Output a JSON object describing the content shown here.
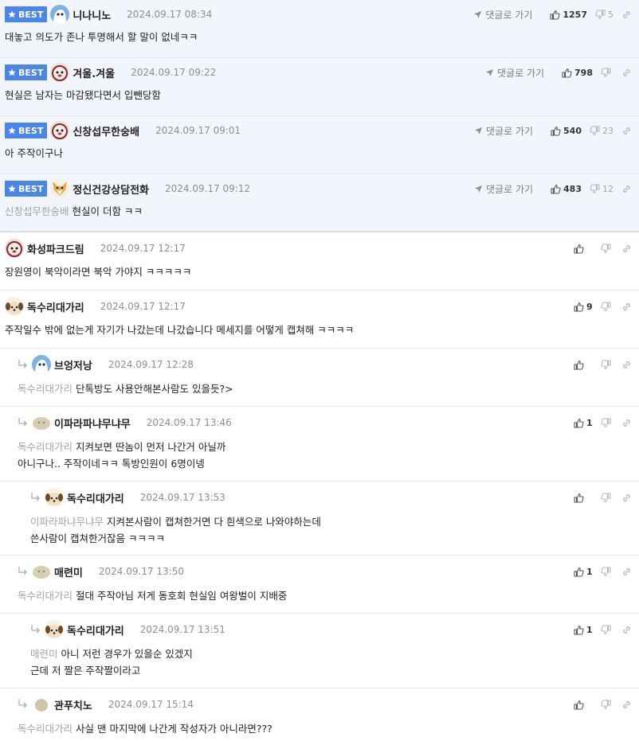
{
  "ui": {
    "best_label": "BEST",
    "reply_link_label": "댓글로 가기"
  },
  "best_comments": [
    {
      "nick": "니나니노",
      "date": "2024.09.17 08:34",
      "likes": "1257",
      "dislikes": "5",
      "mention": "",
      "text": "대놓고 의도가 존나 투명해서 할 말이 없네ㅋㅋ",
      "avatar": "blue-owl"
    },
    {
      "nick": "겨울.겨울",
      "date": "2024.09.17 09:22",
      "likes": "798",
      "dislikes": "",
      "mention": "",
      "text": "현실은 남자는 마감됐다면서 입뺀당함",
      "avatar": "red-face"
    },
    {
      "nick": "신창섭무한숭배",
      "date": "2024.09.17 09:01",
      "likes": "540",
      "dislikes": "23",
      "mention": "",
      "text": "아 주작이구나",
      "avatar": "red-face"
    },
    {
      "nick": "정신건강상담전화",
      "date": "2024.09.17 09:12",
      "likes": "483",
      "dislikes": "12",
      "mention": "신창섭무한숭배",
      "text": "현실이 더함 ㅋㅋ",
      "avatar": "fox"
    }
  ],
  "comments": [
    {
      "nick": "화성파크드림",
      "date": "2024.09.17 12:17",
      "likes": "",
      "mention": "",
      "lines": [
        "장원영이 북악이라면 북악 가야지 ㅋㅋㅋㅋㅋ"
      ],
      "avatar": "red-face"
    },
    {
      "nick": "독수리대가리",
      "date": "2024.09.17 12:17",
      "likes": "9",
      "mention": "",
      "lines": [
        "주작일수 밖에 없는게 자기가 나갔는데 나갔습니다 메세지를 어떻게 캡쳐해 ㅋㅋㅋㅋ"
      ],
      "avatar": "dog"
    },
    {
      "nick": "브엉저낭",
      "date": "2024.09.17 12:28",
      "likes": "",
      "mention": "독수리대가리",
      "lines": [
        "단톡방도 사용안해본사람도 있을듯?>"
      ],
      "avatar": "blue-owl"
    },
    {
      "nick": "이파라파냐무냐무",
      "date": "2024.09.17 13:46",
      "likes": "1",
      "mention": "독수리대가리",
      "lines": [
        "지켜보면 딴놈이 먼저 나간거 아닐까",
        "아니구나.. 주작이네ㅋㅋ 톡방인원이 6명이넹"
      ],
      "avatar": "beige"
    },
    {
      "nick": "독수리대가리",
      "date": "2024.09.17 13:53",
      "likes": "",
      "mention": "이파라파냐무냐무",
      "lines": [
        "지켜본사람이 캡쳐한거면 다 흰색으로 나와야하는데",
        "쓴사람이 캡쳐한거잖음 ㅋㅋㅋㅋ"
      ],
      "avatar": "dog"
    },
    {
      "nick": "매련미",
      "date": "2024.09.17 13:50",
      "likes": "1",
      "mention": "독수리대가리",
      "lines": [
        "절대 주작아님 저게 동호회 현실임 여왕벌이 지배중"
      ],
      "avatar": "beige"
    },
    {
      "nick": "독수리대가리",
      "date": "2024.09.17 13:51",
      "likes": "1",
      "mention": "매련미",
      "lines": [
        "아니 저런 경우가 있을순 있겠지",
        "근데 저 짤은 주작짤이라고"
      ],
      "avatar": "dog"
    },
    {
      "nick": "관푸치노",
      "date": "2024.09.17 15:14",
      "likes": "",
      "mention": "독수리대가리",
      "lines": [
        "사실 맨 마지막에 나간게 작성자가 아니라면???"
      ],
      "avatar": "beige-small"
    }
  ]
}
